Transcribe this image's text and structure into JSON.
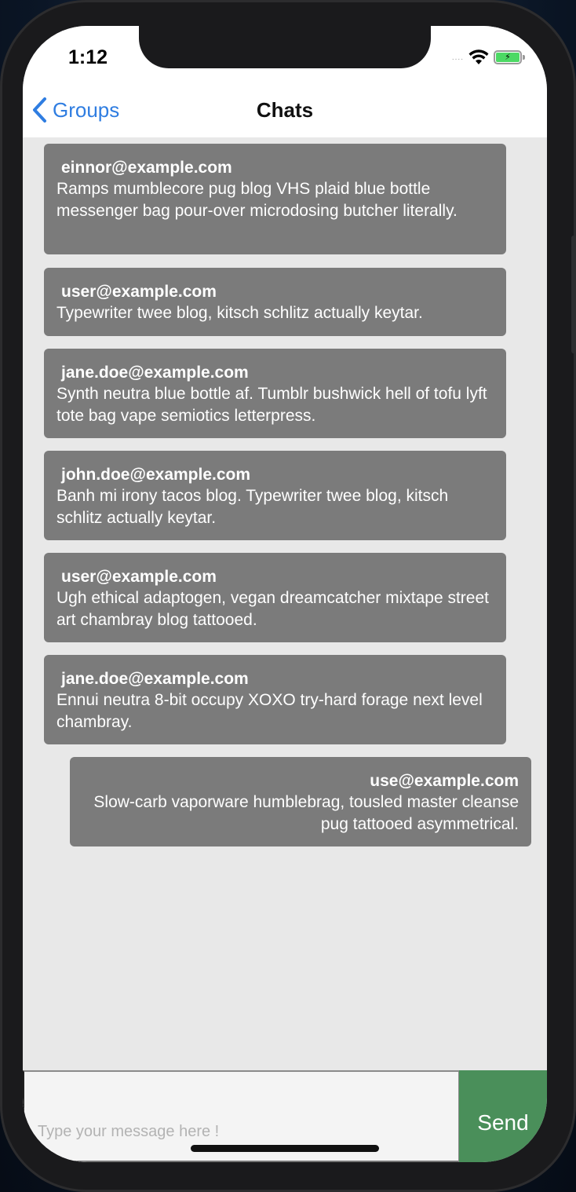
{
  "status_bar": {
    "time": "1:12",
    "signal": "....",
    "battery_charging_symbol": "⚡"
  },
  "nav": {
    "back_label": "Groups",
    "title": "Chats"
  },
  "messages": [
    {
      "sender": "einnor@example.com",
      "text": "Ramps mumblecore pug blog VHS plaid blue bottle messenger bag pour-over microdosing butcher literally.",
      "side": "left"
    },
    {
      "sender": "user@example.com",
      "text": "Typewriter twee blog, kitsch schlitz actually keytar.",
      "side": "left"
    },
    {
      "sender": "jane.doe@example.com",
      "text": "Synth neutra blue bottle af. Tumblr bushwick hell of tofu lyft tote bag vape semiotics letterpress.",
      "side": "left"
    },
    {
      "sender": "john.doe@example.com",
      "text": "Banh mi irony tacos blog. Typewriter twee blog, kitsch schlitz actually keytar.",
      "side": "left"
    },
    {
      "sender": "user@example.com",
      "text": "Ugh ethical adaptogen, vegan dreamcatcher mixtape street art chambray blog tattooed.",
      "side": "left"
    },
    {
      "sender": "jane.doe@example.com",
      "text": "Ennui neutra 8-bit occupy XOXO try-hard forage next level chambray.",
      "side": "left"
    },
    {
      "sender": "use@example.com",
      "text": "Slow-carb vaporware humblebrag, tousled master cleanse pug tattooed asymmetrical.",
      "side": "right"
    }
  ],
  "composer": {
    "placeholder": "Type your message here !",
    "value": "",
    "send_label": "Send"
  },
  "colors": {
    "accent": "#2f7de1",
    "bubble": "#7b7b7b",
    "send_button": "#4a8f5a",
    "background": "#e8e8e8"
  }
}
